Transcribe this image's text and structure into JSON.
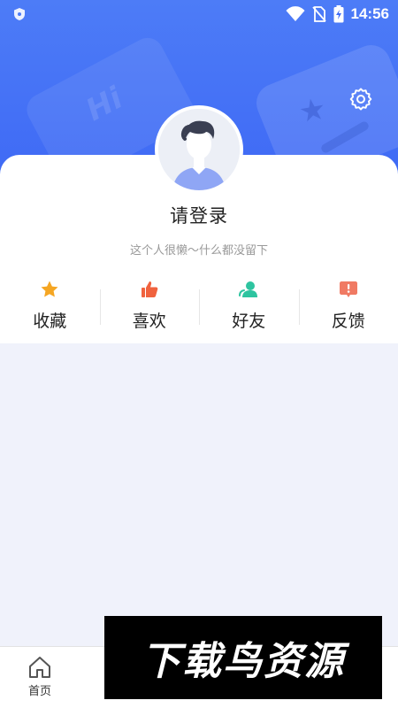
{
  "status_bar": {
    "time": "14:56",
    "icons": [
      "shield-icon",
      "wifi-icon",
      "no-sim-icon",
      "battery-charging-icon"
    ]
  },
  "header": {
    "decoration_text": "Hi",
    "settings_icon": "gear-icon",
    "accent_color": "#3f6af5"
  },
  "profile": {
    "login_prompt": "请登录",
    "bio": "这个人很懒～什么都没留下"
  },
  "actions": [
    {
      "label": "收藏",
      "icon": "star-icon",
      "color": "#f5a623"
    },
    {
      "label": "喜欢",
      "icon": "thumbs-up-icon",
      "color": "#f0623e"
    },
    {
      "label": "好友",
      "icon": "friends-icon",
      "color": "#2ec4a0"
    },
    {
      "label": "反馈",
      "icon": "feedback-icon",
      "color": "#f07a63"
    }
  ],
  "bottom_nav": {
    "home_label": "首页",
    "home_icon": "home-icon"
  },
  "watermark": {
    "text": "下载鸟资源"
  }
}
